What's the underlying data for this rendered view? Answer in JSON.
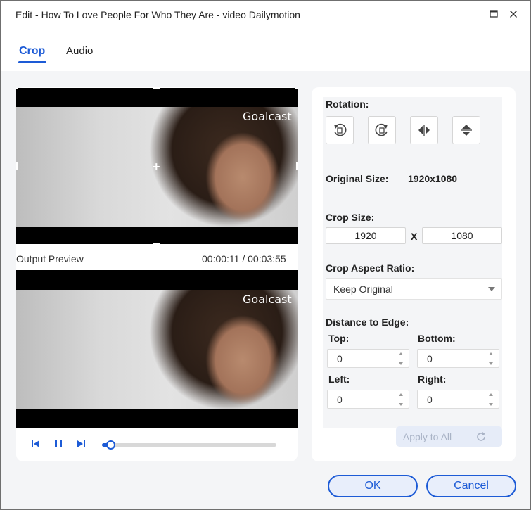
{
  "window": {
    "title": "Edit - How To Love People For Who They Are - video Dailymotion",
    "maximize_icon": "maximize-icon",
    "close_icon": "close-icon"
  },
  "tabs": [
    {
      "label": "Crop",
      "active": true
    },
    {
      "label": "Audio",
      "active": false
    }
  ],
  "preview": {
    "video_logo": "Goalcast",
    "output_label": "Output Preview",
    "time": "00:00:11 / 00:03:55",
    "progress_fraction": 0.047
  },
  "crop_settings": {
    "rotation_label": "Rotation:",
    "rotation_buttons": [
      "rotate-left-icon",
      "rotate-right-icon",
      "flip-horizontal-icon",
      "flip-vertical-icon"
    ],
    "original_size_label": "Original Size:",
    "original_size_value": "1920x1080",
    "crop_size_label": "Crop Size:",
    "crop_width": "1920",
    "crop_separator": "X",
    "crop_height": "1080",
    "aspect_ratio_label": "Crop Aspect Ratio:",
    "aspect_ratio_value": "Keep Original",
    "distance_label": "Distance to Edge:",
    "top_label": "Top:",
    "top_value": "0",
    "bottom_label": "Bottom:",
    "bottom_value": "0",
    "left_label": "Left:",
    "left_value": "0",
    "right_label": "Right:",
    "right_value": "0",
    "apply_label": "Apply to All"
  },
  "footer": {
    "ok_label": "OK",
    "cancel_label": "Cancel"
  },
  "colors": {
    "accent": "#1d5bd6",
    "panel_bg": "#f4f5f7"
  }
}
